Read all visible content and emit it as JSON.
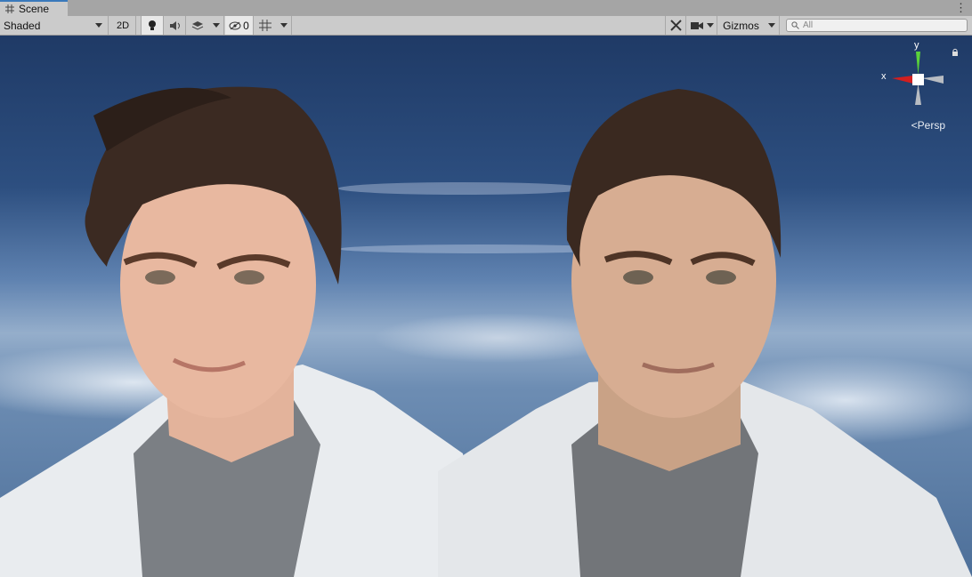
{
  "tab": {
    "title": "Scene",
    "icon": "grid-icon"
  },
  "toolbar": {
    "shading_mode": "Shaded",
    "mode_2d": "2D",
    "hidden_count": "0",
    "gizmos_label": "Gizmos",
    "search_placeholder": "All"
  },
  "gizmo": {
    "x_label": "x",
    "y_label": "y",
    "projection": "Persp"
  },
  "colors": {
    "tab_accent": "#3a79bb",
    "toolbar_bg": "#cbcbcb",
    "tabbar_bg": "#a5a5a5",
    "x_axis": "#d21f1f",
    "y_axis": "#5ad23a"
  }
}
